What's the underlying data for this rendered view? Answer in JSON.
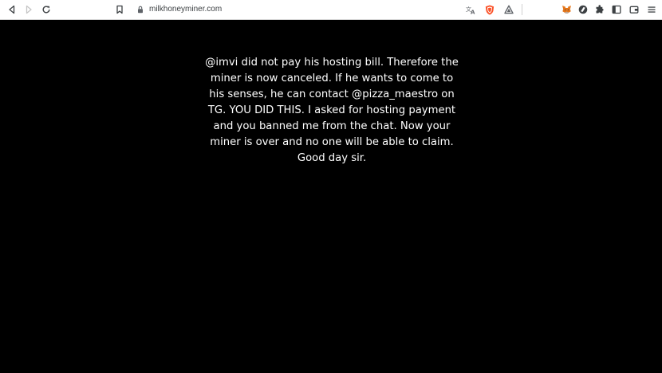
{
  "browser": {
    "url": "milkhoneyminer.com",
    "icons": {
      "back": "back-arrow-icon",
      "forward": "forward-arrow-icon",
      "reload": "reload-icon",
      "bookmark": "bookmark-icon",
      "site_info": "lock-icon",
      "translate": "translate-icon",
      "shield": "brave-shield-icon",
      "rewards": "brave-rewards-icon",
      "metamask": "metamask-fox-icon",
      "extension_circle": "circle-extension-icon",
      "extensions": "puzzle-extensions-icon",
      "sidebar": "sidebar-icon",
      "wallet": "wallet-icon",
      "menu": "menu-icon"
    }
  },
  "page": {
    "message": "@imvi did not pay his hosting bill. Therefore the miner is now canceled. If he wants to come to his senses, he can contact @pizza_maestro on TG. YOU DID THIS. I asked for hosting payment and you banned me from the chat. Now your miner is over and no one will be able to claim. Good day sir.",
    "background": "#000000",
    "text_color": "#ffffff"
  }
}
